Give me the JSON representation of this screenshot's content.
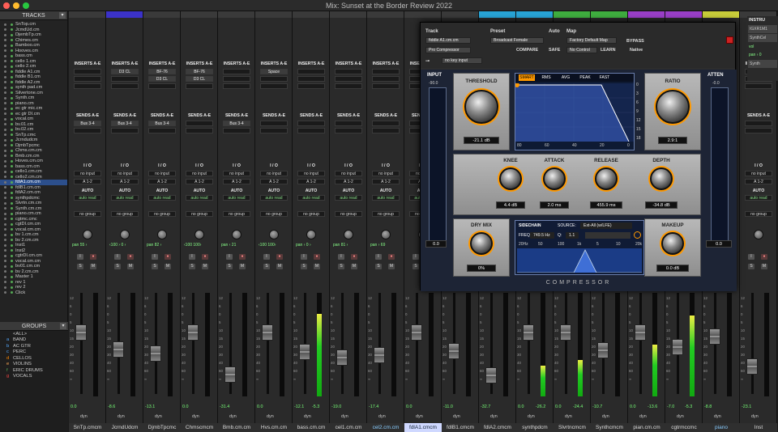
{
  "window": {
    "title": "Mix: Sunset at the Border Review 2022"
  },
  "tracks_panel": {
    "header": "TRACKS",
    "items": [
      "SnTop.cm",
      "JcmdUd.cm",
      "DjembTp.cm",
      "Chimes.cm",
      "Bamboo.cm",
      "Hooves.cm",
      "bass.cm",
      "cello 1.cm",
      "cello 2.cm",
      "fiddle A1.cm",
      "fiddle B1.cm",
      "fiddle A2.cm",
      "synth pad.cm",
      "Silvertone.cm",
      "Synth.cm",
      "piano.cm",
      "ec gtr mic.cm",
      "ec gtr DI.cm",
      "vocal.cm",
      "bv.01.cm",
      "bv.02.cm",
      "SnTp.cmc",
      "Jcrndudcm",
      "DjmbTpcmc",
      "Chms.cm.cm",
      "Bmb.cm.cm",
      "Hoves.cm.cm",
      "bass.cm.cm",
      "cello1.cm.cm",
      "cello2.cm.cm",
      "fdlA1.cm.cm",
      "fdlB1.cm.cm",
      "fdlA2.cm.cm",
      "synthpdcmc",
      "Slvrtn.cm.cm",
      "Synth.cm.cm",
      "piano.cm.cm",
      "cgtmc.cmc",
      "cgtDI.cm.cm",
      "vocal.cm.cm",
      "bv 1.cm.cm",
      "bv 2.cm.cm",
      "Inst1",
      "Inst2",
      "cgtrDI.cm.cm",
      "vocal.cm.cm",
      "bv01.cm.cm",
      "bv 2.cm.cm",
      "Master 1",
      "rev 1",
      "rev 2",
      "Click"
    ],
    "selected": "fdlA1.cm.cm"
  },
  "groups_panel": {
    "header": "GROUPS",
    "items": [
      {
        "key": "",
        "label": "<ALL>"
      },
      {
        "key": "a",
        "label": "BAND"
      },
      {
        "key": "b",
        "label": "AC GTR"
      },
      {
        "key": "c",
        "label": "PERC"
      },
      {
        "key": "d",
        "label": "CELLOS"
      },
      {
        "key": "e",
        "label": "VIOLINS"
      },
      {
        "key": "f",
        "label": "ERIC DRUMS"
      },
      {
        "key": "g",
        "label": "VOCALS"
      }
    ]
  },
  "labels": {
    "inserts": "INSERTS A-E",
    "sends": "SENDS A-E",
    "io": "I / O",
    "auto": "AUTO",
    "no_input": "no input",
    "a12": "A 1-2",
    "auto_read": "auto read",
    "no_group": "no group",
    "i": "I",
    "s": "S",
    "m": "M",
    "dyn": "dyn"
  },
  "strips": [
    {
      "name": "SnTp.cmcm",
      "color": "#3a3a3a",
      "ins": [
        "",
        "",
        ""
      ],
      "send": "Bus 3-4",
      "pan": "pan   55 ›",
      "vol": "0.0",
      "peak": "",
      "fader": 0.35,
      "meter": 0
    },
    {
      "name": "JcrndUdcm",
      "color": "#3a3a3a",
      "ins": [
        "D3 CL",
        "",
        ""
      ],
      "send": "Bus 3-4",
      "pan": "‹100 › 0 ›",
      "vol": "-8.6",
      "peak": "",
      "fader": 0.55,
      "meter": 0
    },
    {
      "name": "DjmbTpcmc",
      "color": "#3a3a3a",
      "ins": [
        "BF-76",
        "D3 CL",
        ""
      ],
      "send": "Bus 3-4",
      "pan": "pan   82 ›",
      "vol": "-13.1",
      "peak": "",
      "fader": 0.6,
      "meter": 0
    },
    {
      "name": "Chmscmcm",
      "color": "#3a3a3a",
      "ins": [
        "BF-76",
        "D3 CL",
        ""
      ],
      "send": "",
      "pan": "‹100  100›",
      "vol": "0.0",
      "peak": "",
      "fader": 0.35,
      "meter": 0
    },
    {
      "name": "Bmb.cm.cm",
      "color": "#3a3a3a",
      "ins": [
        "",
        "",
        ""
      ],
      "send": "Bus 3-4",
      "pan": "pan  ‹ 21",
      "vol": "-31.4",
      "peak": "",
      "fader": 0.85,
      "meter": 0
    },
    {
      "name": "Hvs.cm.cm",
      "color": "#3a3a3a",
      "ins": [
        "Space",
        "",
        ""
      ],
      "send": "",
      "pan": "‹100  100›",
      "vol": "0.0",
      "peak": "",
      "fader": 0.35,
      "meter": 0
    },
    {
      "name": "bass.cm.cm",
      "color": "#3a3a3a",
      "ins": [
        "",
        "",
        ""
      ],
      "send": "",
      "pan": "pan  › 0 ›",
      "vol": "-12.1",
      "peak": "-5.3",
      "fader": 0.58,
      "meter": 0.8
    },
    {
      "name": "cel1.cm.cm",
      "color": "#3a3a3a",
      "ins": [
        "",
        "",
        ""
      ],
      "send": "",
      "pan": "pan   81 ›",
      "vol": "-19.0",
      "peak": "",
      "fader": 0.65,
      "meter": 0
    },
    {
      "name": "cel2.cm.cm",
      "color": "#3a3a3a",
      "ins": [
        "",
        "",
        ""
      ],
      "send": "",
      "pan": "pan  › 69",
      "vol": "-17.4",
      "peak": "",
      "fader": 0.62,
      "meter": 0
    },
    {
      "name": "fdlA1.cmcm",
      "color": "#3a3a3a",
      "ins": [
        "",
        "",
        ""
      ],
      "send": "",
      "pan": "",
      "vol": "0.0",
      "peak": "",
      "fader": 0.35,
      "meter": 0
    },
    {
      "name": "fdlB1.cmcm",
      "color": "#3a3a3a",
      "ins": [
        "",
        "",
        ""
      ],
      "send": "",
      "pan": "",
      "vol": "-11.0",
      "peak": "",
      "fader": 0.57,
      "meter": 0
    },
    {
      "name": "fdlA2.cmcm",
      "color": "#3a3a3a",
      "ins": [
        "",
        "",
        ""
      ],
      "send": "",
      "pan": "",
      "vol": "-32.7",
      "peak": "",
      "fader": 0.86,
      "meter": 0
    },
    {
      "name": "synthpdcm",
      "color": "#3a3a3a",
      "ins": [
        "",
        "",
        ""
      ],
      "send": "",
      "pan": "",
      "vol": "0.0",
      "peak": "-26.2",
      "fader": 0.35,
      "meter": 0.3
    },
    {
      "name": "Slvrtncmcm",
      "color": "#3a3a3a",
      "ins": [
        "",
        "",
        ""
      ],
      "send": "",
      "pan": "",
      "vol": "0.0",
      "peak": "-24.4",
      "fader": 0.35,
      "meter": 0.35
    },
    {
      "name": "Synthcmcm",
      "color": "#3a3a3a",
      "ins": [
        "",
        "",
        ""
      ],
      "send": "",
      "pan": "",
      "vol": "-10.7",
      "peak": "",
      "fader": 0.56,
      "meter": 0
    },
    {
      "name": "pian.cm.cm",
      "color": "#3a3a3a",
      "ins": [
        "",
        "",
        ""
      ],
      "send": "",
      "pan": "",
      "vol": "0.0",
      "peak": "-13.6",
      "fader": 0.35,
      "meter": 0.5
    },
    {
      "name": "cgtrmccmc",
      "color": "#3a3a3a",
      "ins": [
        "",
        "",
        ""
      ],
      "send": "",
      "pan": "",
      "vol": "-7.0",
      "peak": "-5.3",
      "fader": 0.52,
      "meter": 0.78
    },
    {
      "name": "piano",
      "color": "#3a3a3a",
      "ins": [
        "",
        "",
        ""
      ],
      "send": "",
      "pan": "",
      "vol": "-8.8",
      "peak": "",
      "fader": 0.4,
      "meter": 0
    },
    {
      "name": "Inst",
      "color": "#3a3a3a",
      "ins": [
        "",
        "",
        ""
      ],
      "send": "",
      "pan": "",
      "vol": "-23.1",
      "peak": "",
      "fader": 0.75,
      "meter": 0
    }
  ],
  "plugin": {
    "track_label": "Track",
    "preset_label": "Preset",
    "auto_label": "Auto",
    "map_label": "Map",
    "track_value": "fiddle A1.cm.cm",
    "preset_value": "Broadcast Female",
    "map_value": "Factory Default Map",
    "bypass": "BYPASS",
    "plugin_name": "Pro Compressor",
    "compare": "COMPARE",
    "safe": "SAFE",
    "no_control": "No Control",
    "learn": "LEARN",
    "native": "Native",
    "key_input": "no key input",
    "input_label": "INPUT",
    "input_top": "-90.0",
    "input_val": "0.0",
    "threshold_label": "THRESHOLD",
    "threshold_val": "-21.1 dB",
    "tabs": [
      "SMART",
      "RMS",
      "AVG",
      "PEAK",
      "FAST"
    ],
    "graph_x": [
      "80",
      "60",
      "40",
      "20",
      "0"
    ],
    "graph_y": [
      "0",
      "3",
      "6",
      "9",
      "12",
      "15",
      "18"
    ],
    "ratio_label": "RATIO",
    "ratio_val": "2.9:1",
    "atten_label": "ATTEN",
    "atten_top": "-0.0",
    "atten_val": "0.0",
    "knee_label": "KNEE",
    "knee_val": "4.4 dB",
    "attack_label": "ATTACK",
    "attack_val": "2.0 ms",
    "release_label": "RELEASE",
    "release_val": "455.9 ms",
    "depth_label": "DEPTH",
    "depth_val": "-34.8 dB",
    "drymix_label": "DRY MIX",
    "drymix_val": "0%",
    "sidechain_label": "SIDECHAIN",
    "source_label": "SOURCE:",
    "source_val": "Ext-All (w/LFE)",
    "freq_label": "FREQ",
    "freq_val": "749.5 Hz",
    "q_label": "Q:",
    "q_val": "1.1",
    "sc_scale": [
      "20Hz",
      "50",
      "100",
      "1k",
      "5",
      "10",
      "20k"
    ],
    "makeup_label": "MAKEUP",
    "makeup_val": "0.0 dB",
    "footer": "COMPRESSOR"
  },
  "right_panel": {
    "header": "INSTRU",
    "items": [
      "IGXR1M1",
      "SynthCel",
      "vol",
      "pan › 0",
      "Synth"
    ]
  }
}
